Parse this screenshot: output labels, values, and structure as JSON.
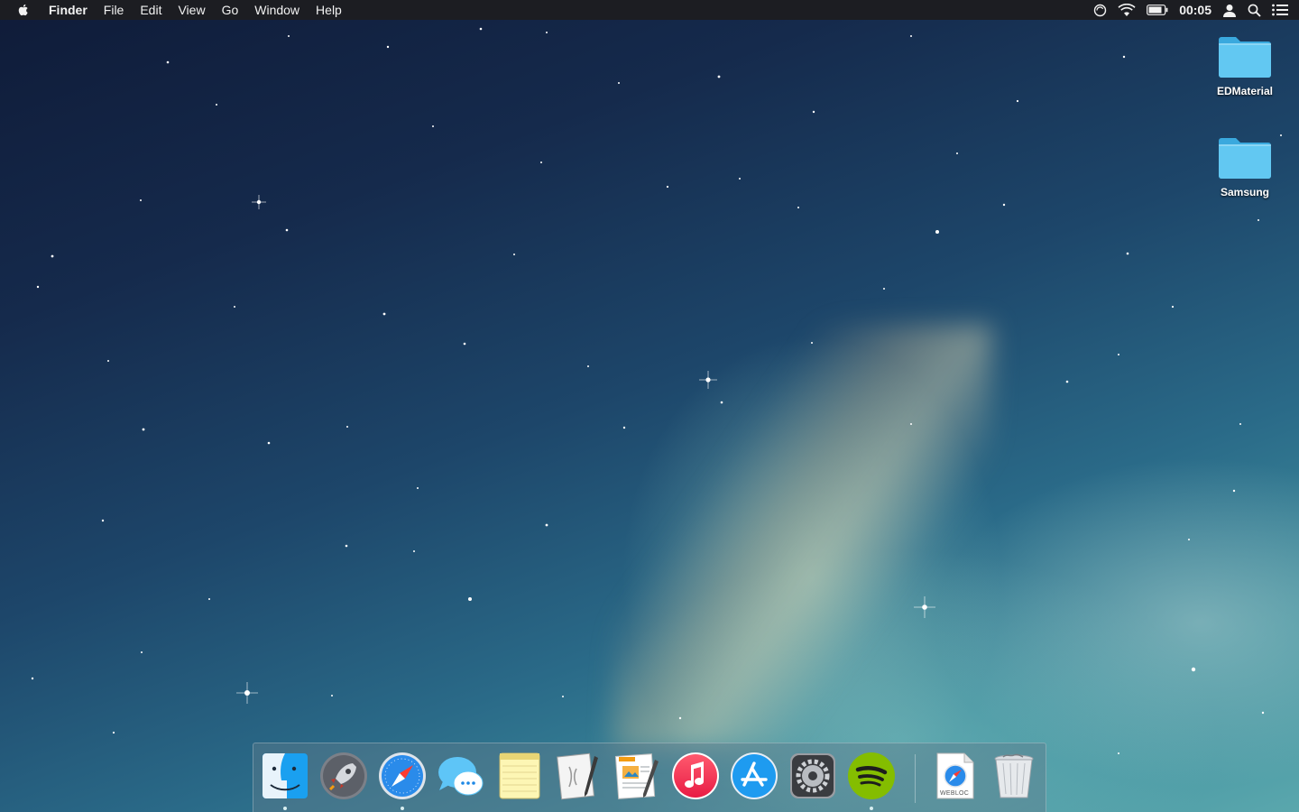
{
  "menubar": {
    "app_name": "Finder",
    "items": [
      "File",
      "Edit",
      "View",
      "Go",
      "Window",
      "Help"
    ],
    "clock": "00:05",
    "status_icons": [
      "clock-sync-icon",
      "wifi-icon",
      "battery-icon",
      "user-icon",
      "spotlight-search-icon",
      "notification-center-icon"
    ]
  },
  "desktop": {
    "icons": [
      {
        "label": "EDMaterial",
        "icon": "folder-icon"
      },
      {
        "label": "Samsung",
        "icon": "folder-icon"
      }
    ]
  },
  "dock": {
    "apps": [
      {
        "name": "finder",
        "running": true
      },
      {
        "name": "launchpad",
        "running": false
      },
      {
        "name": "safari",
        "running": true
      },
      {
        "name": "messages",
        "running": false
      },
      {
        "name": "notes",
        "running": false
      },
      {
        "name": "script-editor",
        "running": false
      },
      {
        "name": "pages",
        "running": false
      },
      {
        "name": "itunes",
        "running": false
      },
      {
        "name": "app-store",
        "running": false
      },
      {
        "name": "system-preferences",
        "running": false
      },
      {
        "name": "spotify",
        "running": true
      }
    ],
    "extras": [
      {
        "name": "webloc-file",
        "badge": "WEBLOC"
      },
      {
        "name": "trash"
      }
    ]
  },
  "colors": {
    "menubar_bg": "#1c1d22",
    "folder_blue": "#5bc4ef",
    "spotify_green": "#84bd00",
    "itunes_red": "#f0304a"
  }
}
